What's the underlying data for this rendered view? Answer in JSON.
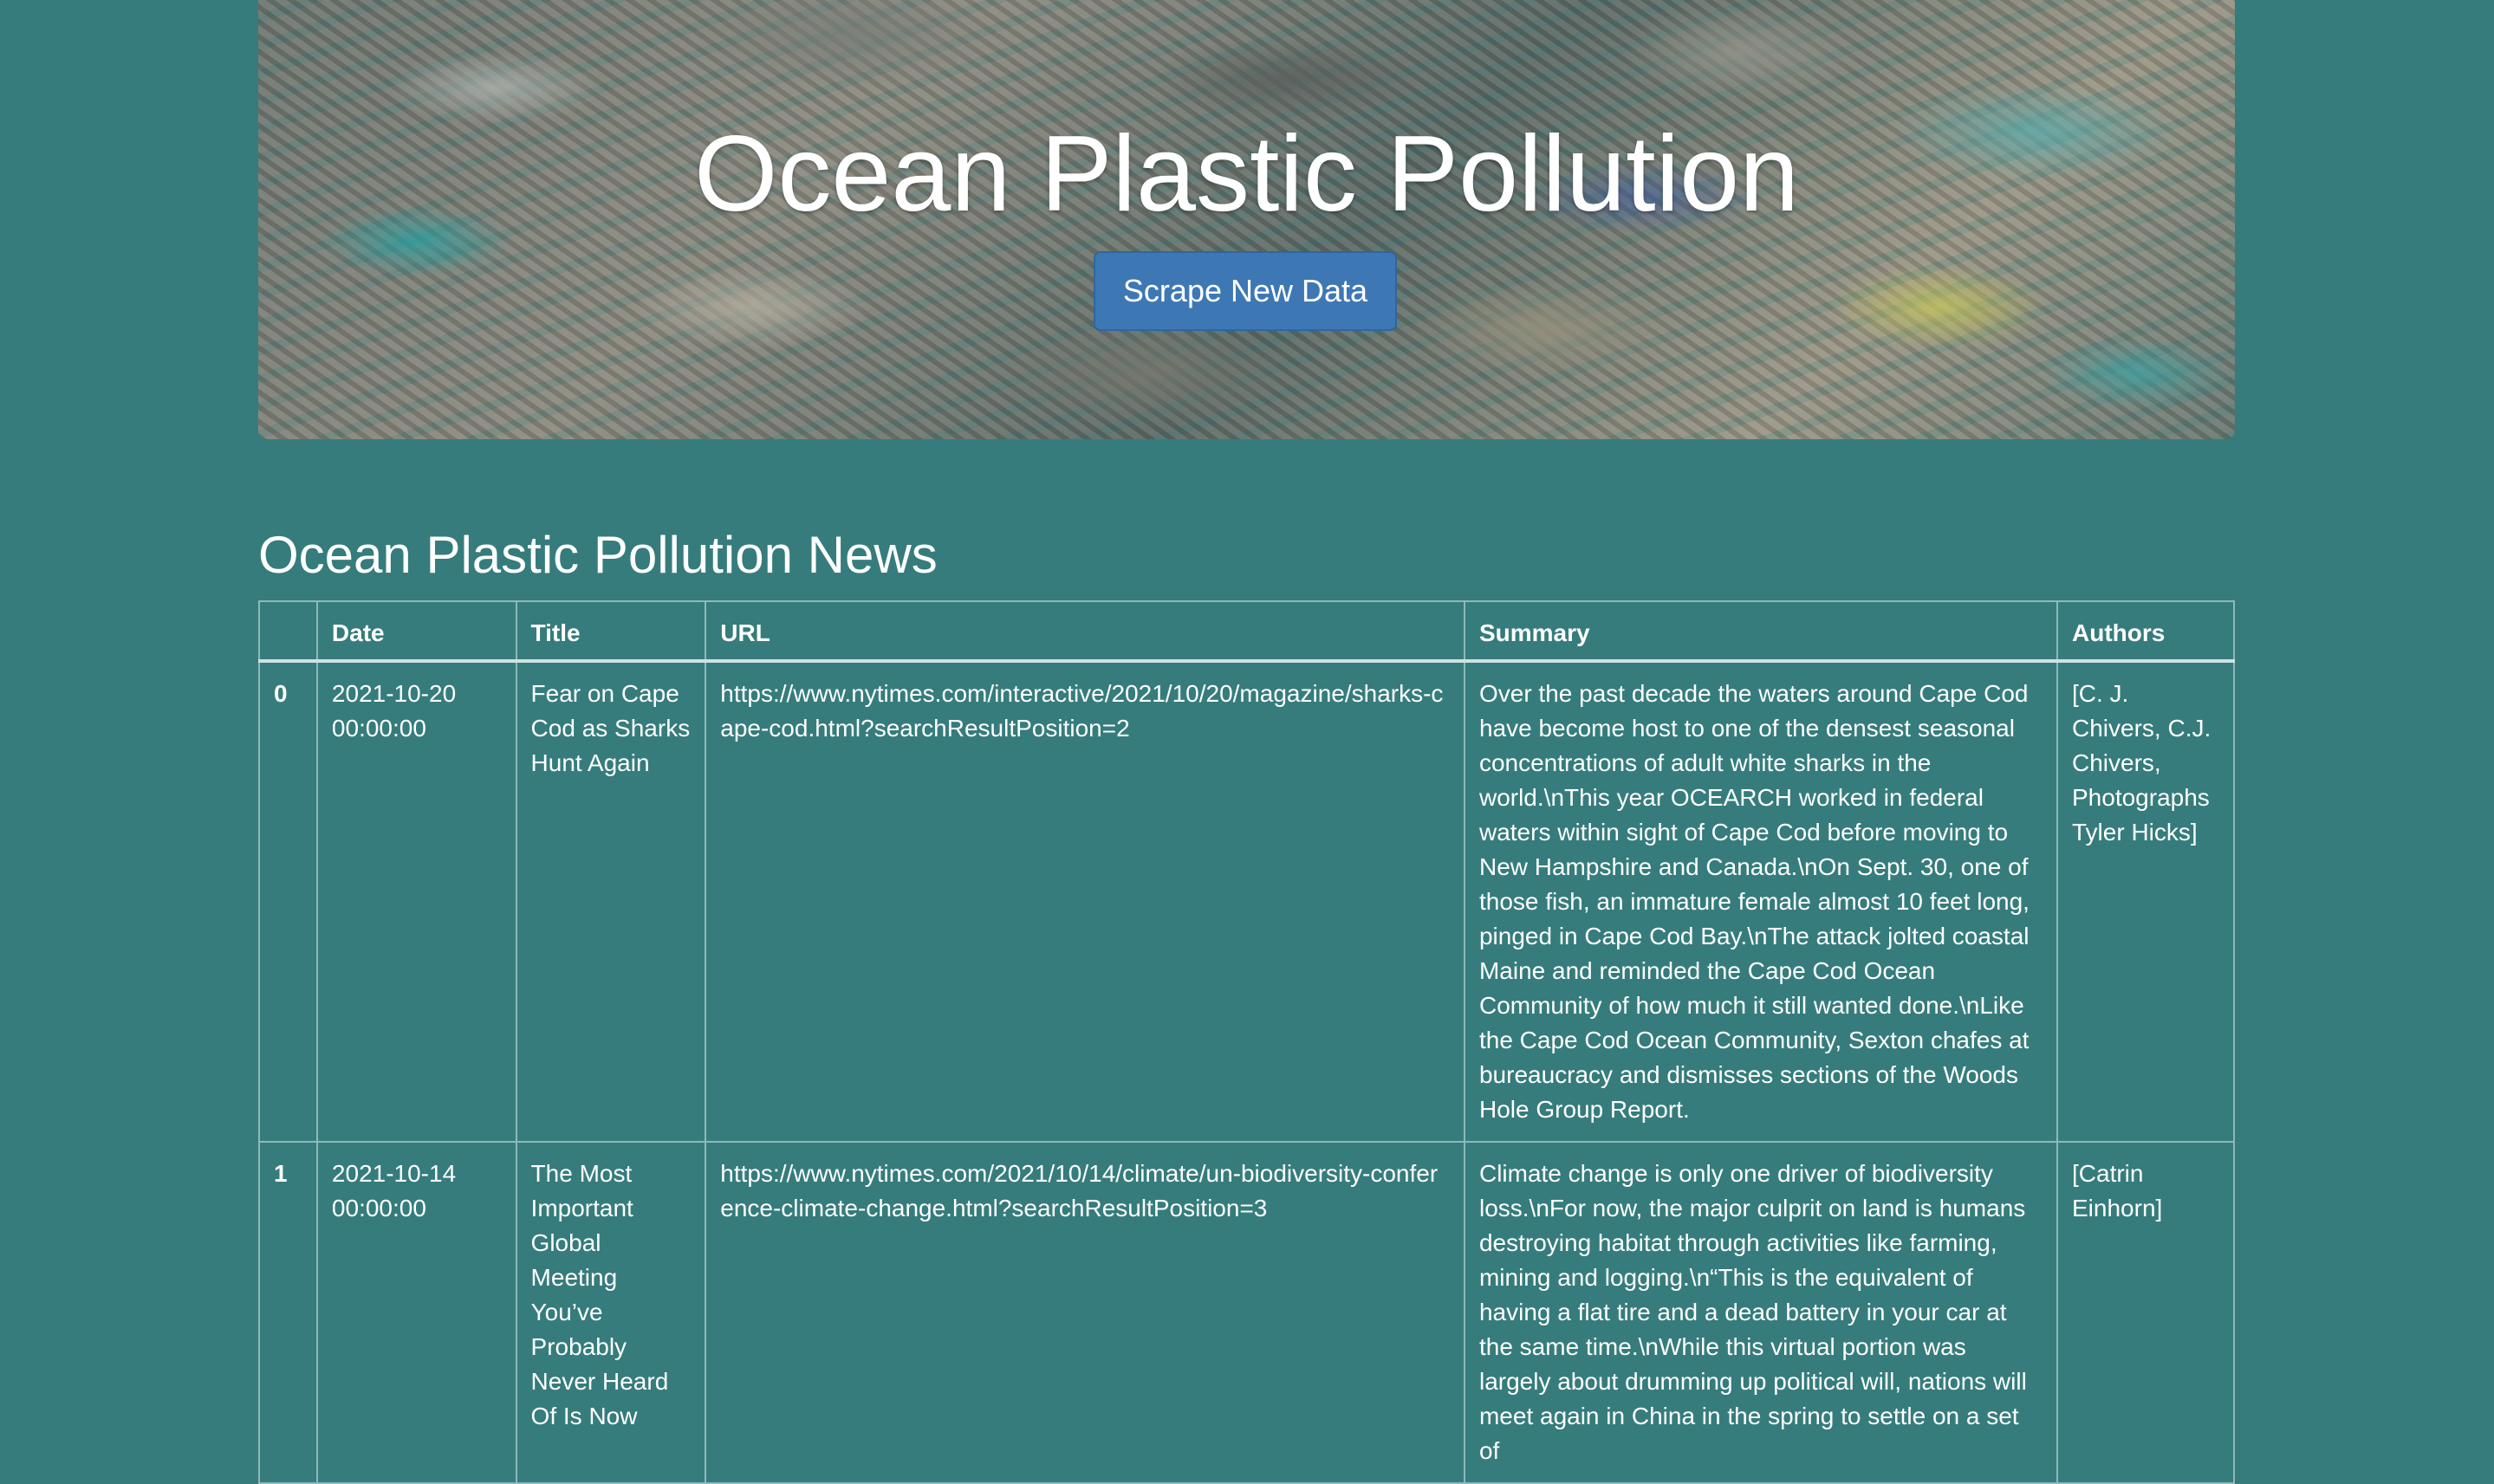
{
  "header": {
    "title": "Ocean Plastic Pollution",
    "scrape_button": "Scrape New Data"
  },
  "news": {
    "heading": "Ocean Plastic Pollution News",
    "columns": [
      "",
      "Date",
      "Title",
      "URL",
      "Summary",
      "Authors"
    ],
    "rows": [
      {
        "index": "0",
        "date": "2021-10-20 00:00:00",
        "title": "Fear on Cape Cod as Sharks Hunt Again",
        "url": "https://www.nytimes.com/interactive/2021/10/20/magazine/sharks-cape-cod.html?searchResultPosition=2",
        "summary": "Over the past decade the waters around Cape Cod have become host to one of the densest seasonal concentrations of adult white sharks in the world.\\nThis year OCEARCH worked in federal waters within sight of Cape Cod before moving to New Hampshire and Canada.\\nOn Sept. 30, one of those fish, an immature female almost 10 feet long, pinged in Cape Cod Bay.\\nThe attack jolted coastal Maine and reminded the Cape Cod Ocean Community of how much it still wanted done.\\nLike the Cape Cod Ocean Community, Sexton chafes at bureaucracy and dismisses sections of the Woods Hole Group Report.",
        "authors": "[C. J. Chivers, C.J. Chivers, Photographs Tyler Hicks]"
      },
      {
        "index": "1",
        "date": "2021-10-14 00:00:00",
        "title": "The Most Important Global Meeting You’ve Probably Never Heard Of Is Now",
        "url": "https://www.nytimes.com/2021/10/14/climate/un-biodiversity-conference-climate-change.html?searchResultPosition=3",
        "summary": "Climate change is only one driver of biodiversity loss.\\nFor now, the major culprit on land is humans destroying habitat through activities like farming, mining and logging.\\n“This is the equivalent of having a flat tire and a dead battery in your car at the same time.\\nWhile this virtual portion was largely about drumming up political will, nations will meet again in China in the spring to settle on a set of",
        "authors": "[Catrin Einhorn]"
      }
    ]
  }
}
